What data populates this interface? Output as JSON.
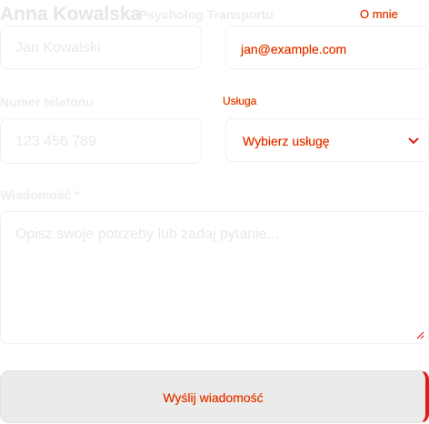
{
  "header": {
    "brand_name": "Anna Kowalska",
    "brand_subtitle": "Psycholog Transportu",
    "nav_link": "O mnie"
  },
  "form": {
    "name_placeholder": "Jan Kowalski",
    "email_value": "jan@example.com",
    "phone_label": "Numer telefonu",
    "phone_placeholder": "123 456 789",
    "topic_label": "Usługa",
    "topic_value": "Wybierz usługę",
    "message_label": "Wiadomość *",
    "message_placeholder": "Opisz swoje potrzeby lub zadaj pytanie...",
    "submit_label": "Wyślij wiadomość"
  },
  "colors": {
    "accent": "#e01b1b",
    "accent_glow": "#f2d200",
    "muted_text": "#e6e6e6"
  },
  "icons": {
    "select_chevron": "chevron-down-icon",
    "resize_grip": "resize-grip-icon"
  }
}
